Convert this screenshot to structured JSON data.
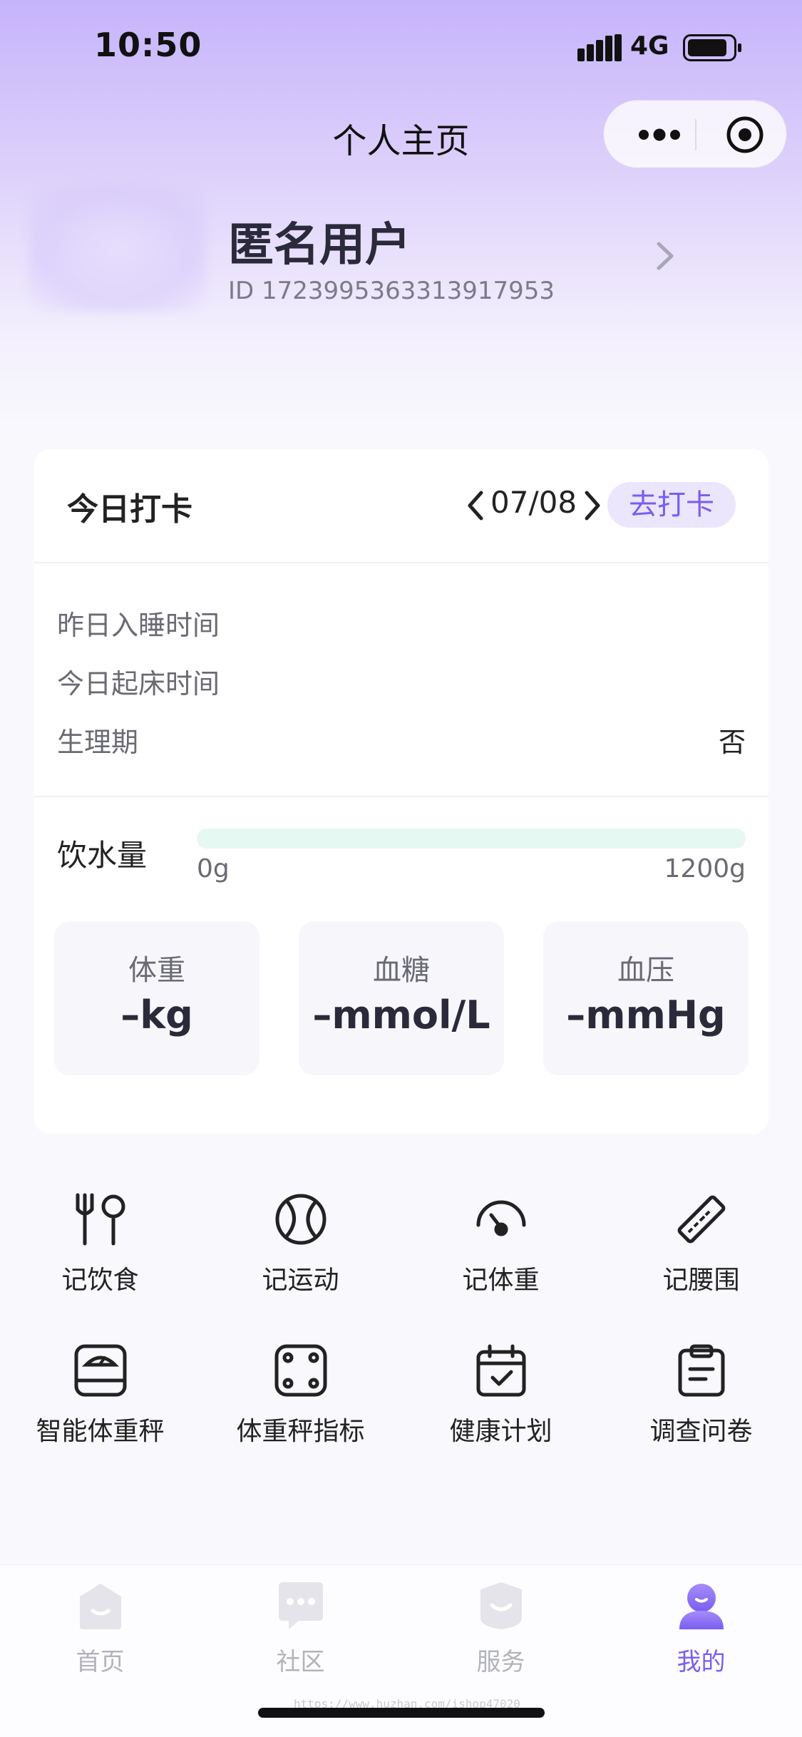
{
  "status_bar": {
    "time": "10:50",
    "network": "4G"
  },
  "nav": {
    "title": "个人主页"
  },
  "profile": {
    "name": "匿名用户",
    "id_text": "ID 1723995363313917953"
  },
  "checkin_card": {
    "title": "今日打卡",
    "date": "07/08",
    "checkin_button": "去打卡",
    "rows": [
      {
        "label": "昨日入睡时间",
        "value": ""
      },
      {
        "label": "今日起床时间",
        "value": ""
      },
      {
        "label": "生理期",
        "value": "否"
      }
    ],
    "water": {
      "label": "饮水量",
      "min_label": "0g",
      "max_label": "1200g",
      "current": 0,
      "goal": 1200
    },
    "metrics": [
      {
        "label": "体重",
        "value": "–kg"
      },
      {
        "label": "血糖",
        "value": "–mmol/L"
      },
      {
        "label": "血压",
        "value": "–mmHg"
      }
    ]
  },
  "shortcuts": [
    {
      "label": "记饮食",
      "icon": "fork-spoon-icon"
    },
    {
      "label": "记运动",
      "icon": "tennis-ball-icon"
    },
    {
      "label": "记体重",
      "icon": "gauge-icon"
    },
    {
      "label": "记腰围",
      "icon": "ruler-icon"
    },
    {
      "label": "智能体重秤",
      "icon": "smart-scale-icon"
    },
    {
      "label": "体重秤指标",
      "icon": "scale-metrics-icon"
    },
    {
      "label": "健康计划",
      "icon": "calendar-check-icon"
    },
    {
      "label": "调查问卷",
      "icon": "clipboard-icon"
    }
  ],
  "tabbar": {
    "tabs": [
      {
        "label": "首页",
        "icon": "home-icon",
        "active": false
      },
      {
        "label": "社区",
        "icon": "chat-bubble-icon",
        "active": false
      },
      {
        "label": "服务",
        "icon": "service-shield-icon",
        "active": false
      },
      {
        "label": "我的",
        "icon": "user-icon",
        "active": true
      }
    ]
  },
  "watermark": "https://www.huzhan.com/ishop47020",
  "colors": {
    "accent": "#7a5df0",
    "accent_light": "#ebe6fc",
    "water_track": "#e6f8f2",
    "hero_top": "#c6b4fb"
  }
}
